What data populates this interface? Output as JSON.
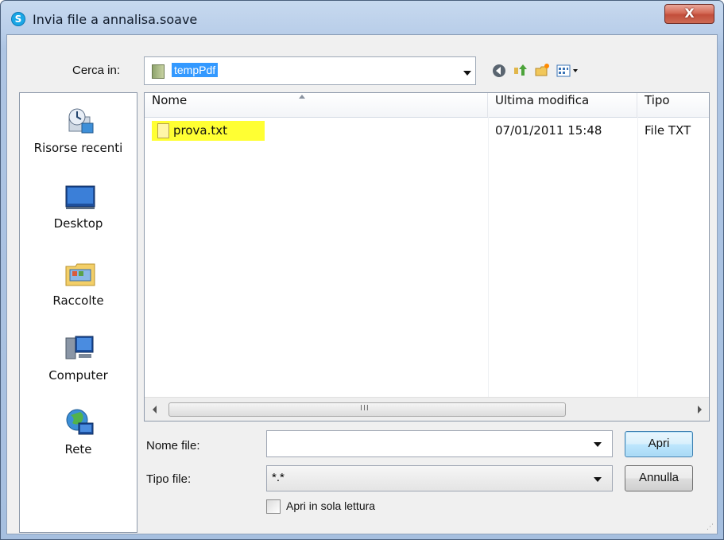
{
  "window": {
    "title": "Invia file a annalisa.soave",
    "close_label": "X",
    "app_icon_letter": "S"
  },
  "lookin": {
    "label": "Cerca in:",
    "value": "tempPdf"
  },
  "toolbar": {
    "icons": [
      "back-icon",
      "up-folder-icon",
      "new-folder-icon",
      "view-menu-icon"
    ]
  },
  "places": [
    {
      "label": "Risorse recenti",
      "icon": "recent-places-icon"
    },
    {
      "label": "Desktop",
      "icon": "desktop-icon"
    },
    {
      "label": "Raccolte",
      "icon": "libraries-icon"
    },
    {
      "label": "Computer",
      "icon": "computer-icon"
    },
    {
      "label": "Rete",
      "icon": "network-icon"
    }
  ],
  "columns": [
    "Nome",
    "Ultima modifica",
    "Tipo"
  ],
  "files": [
    {
      "name": "prova.txt",
      "modified": "07/01/2011 15:48",
      "type": "File TXT",
      "highlight": "#ffff33"
    }
  ],
  "scrollbar": {
    "grip": "III"
  },
  "filename": {
    "label": "Nome file:",
    "value": ""
  },
  "filetype": {
    "label": "Tipo file:",
    "value": "*.*"
  },
  "readonly": {
    "label": "Apri in sola lettura",
    "checked": false
  },
  "buttons": {
    "open": "Apri",
    "cancel": "Annulla"
  }
}
